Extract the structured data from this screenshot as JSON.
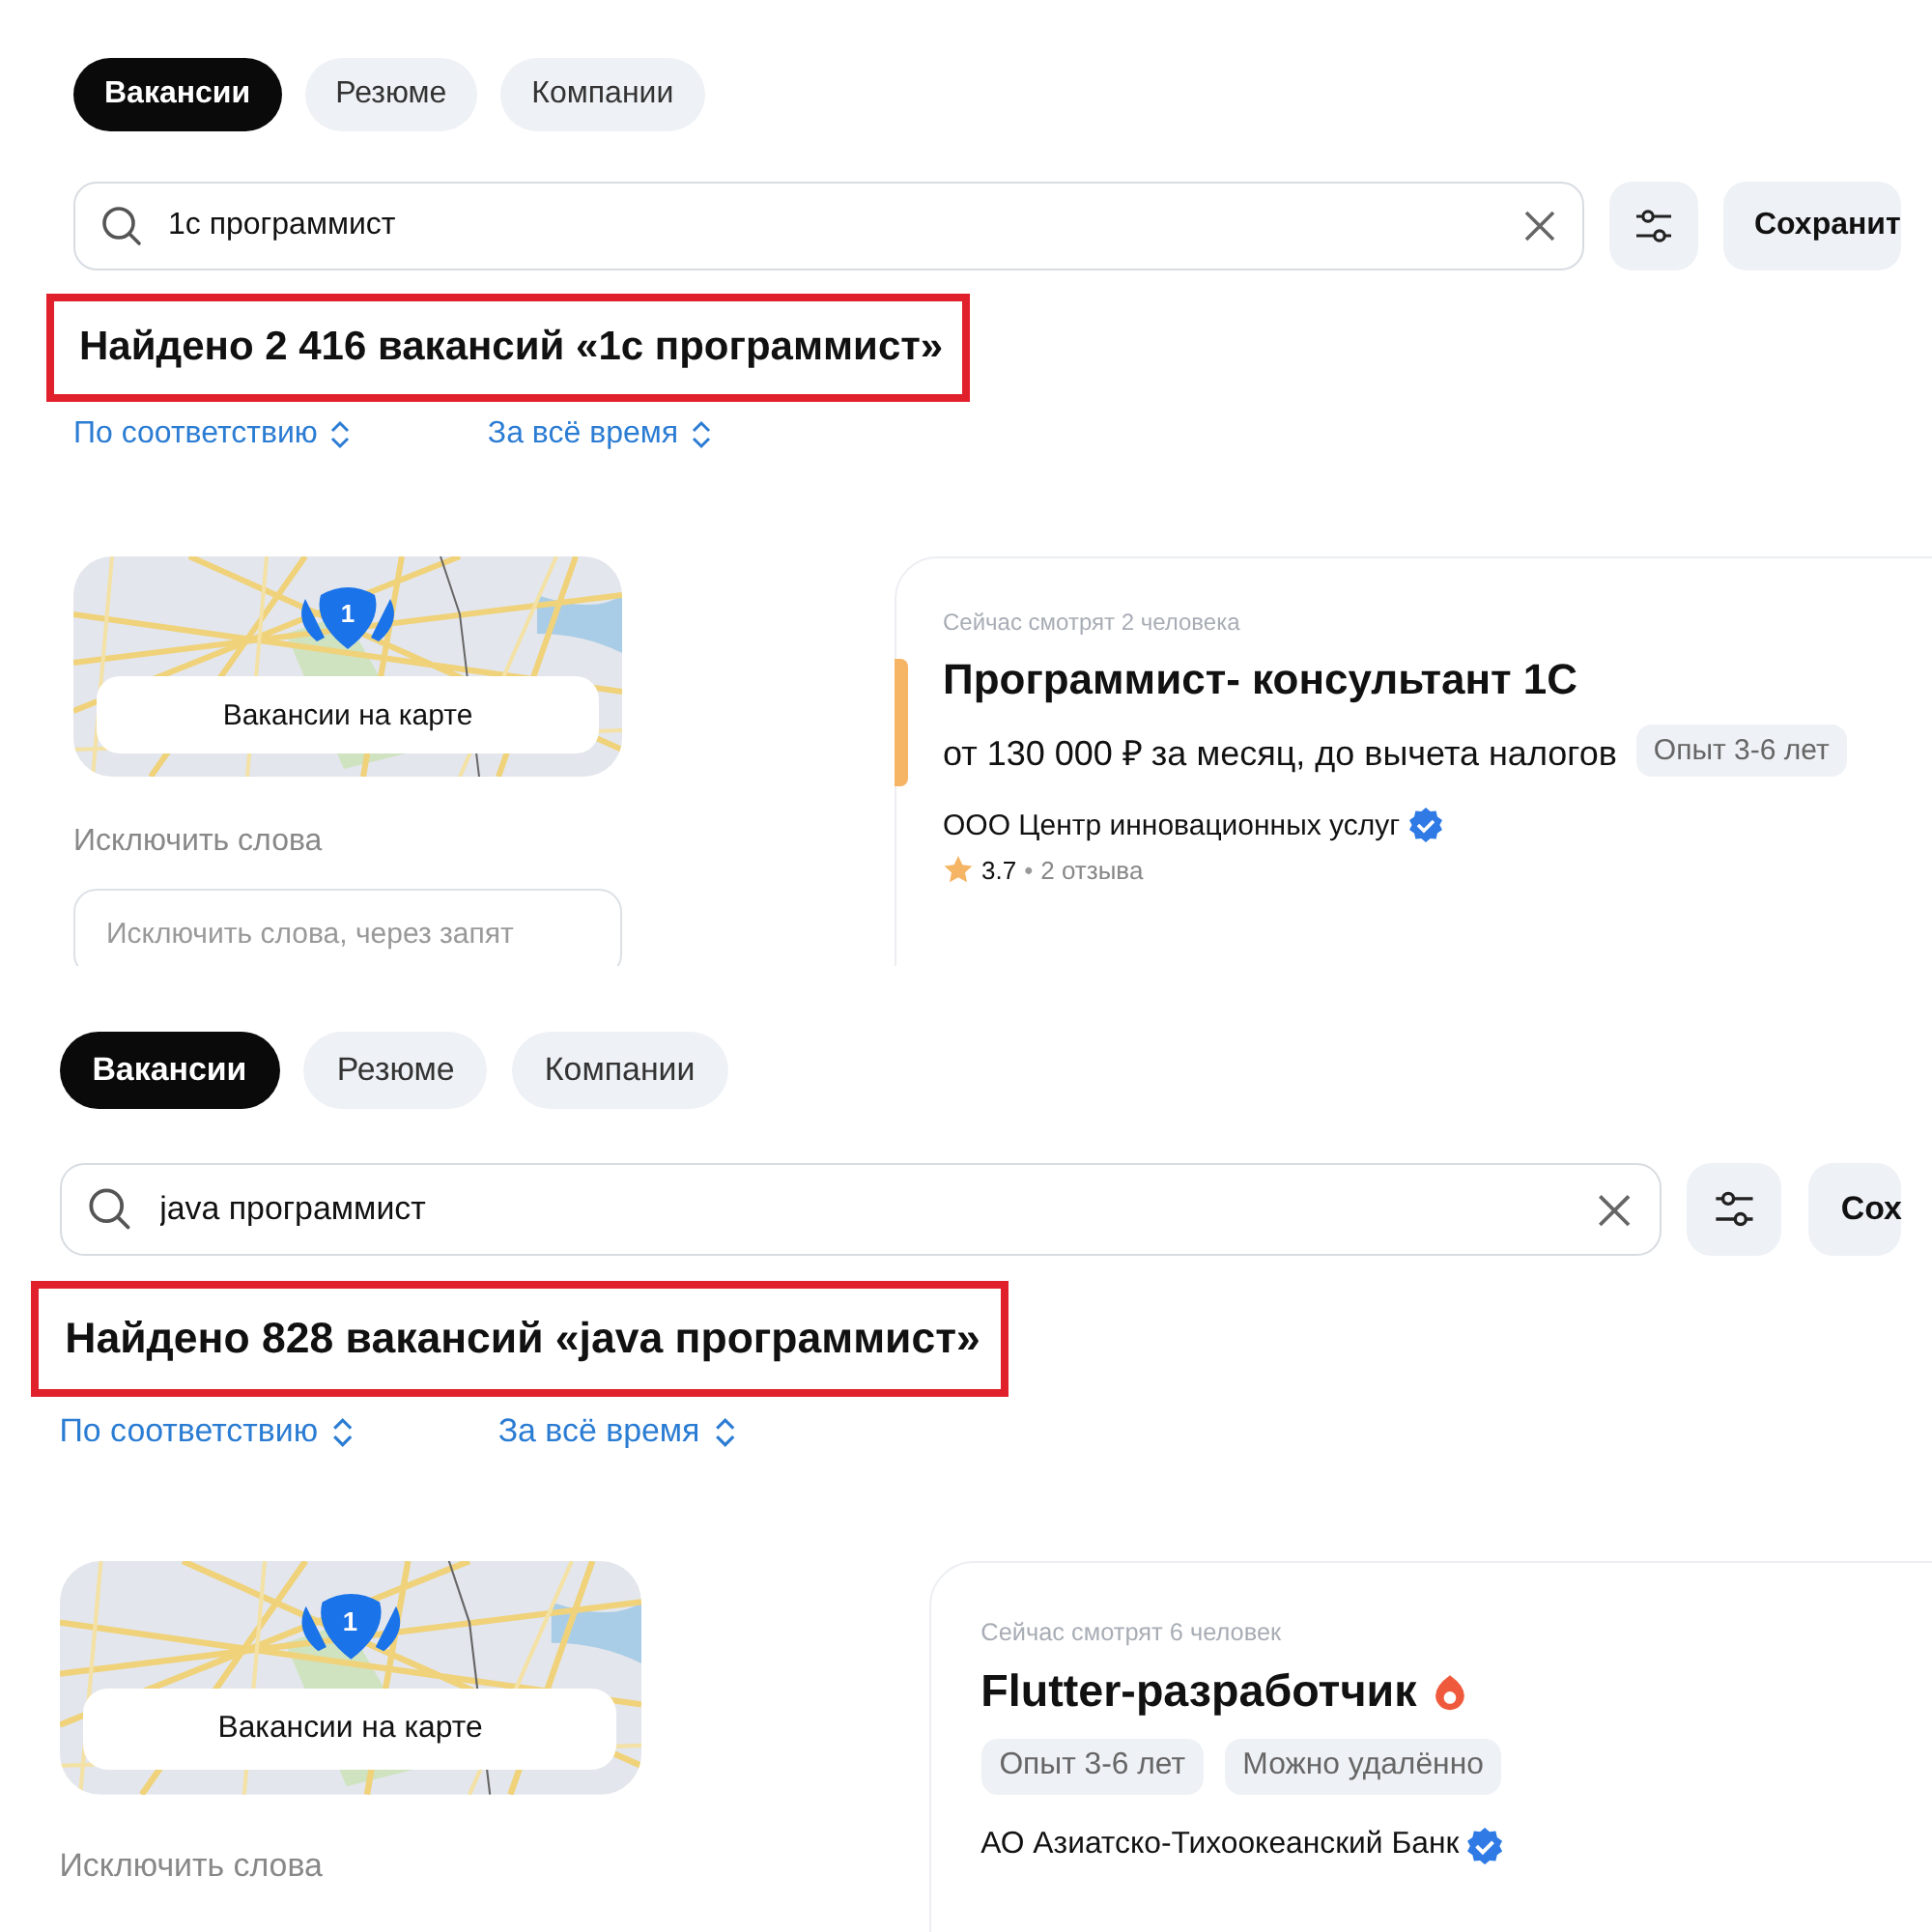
{
  "panels": [
    {
      "tabs": [
        {
          "label": "Вакансии",
          "selected": true
        },
        {
          "label": "Резюме",
          "selected": false
        },
        {
          "label": "Компании",
          "selected": false
        }
      ],
      "search": {
        "value": "1с программист"
      },
      "save_button": "Сохранит",
      "heading": {
        "text": "Найдено 2 416 вакансий «1с программист»",
        "outlined": true
      },
      "sort": [
        "По соответствию",
        "За всё время"
      ],
      "map": {
        "badge": "1",
        "button": "Вакансии на карте"
      },
      "exclude": {
        "label": "Исключить слова",
        "placeholder": "Исключить слова, через запят"
      },
      "vacancy": {
        "watchers": "Сейчас смотрят 2 человека",
        "title": "Программист- консультант 1С",
        "hot": false,
        "highlighted": true,
        "salary": "от 130 000 ₽ за месяц, до вычета налогов",
        "tags": [
          "Опыт 3-6 лет"
        ],
        "company": "ООО Центр инновационных услуг",
        "verified": true,
        "rating": "3.7",
        "separator": "•",
        "reviews": "2 отзыва"
      }
    },
    {
      "tabs": [
        {
          "label": "Вакансии",
          "selected": true
        },
        {
          "label": "Резюме",
          "selected": false
        },
        {
          "label": "Компании",
          "selected": false
        }
      ],
      "search": {
        "value": "java программист"
      },
      "save_button": "Сох",
      "heading": {
        "text": "Найдено 828 вакансий «java программист»",
        "outlined": true
      },
      "sort": [
        "По соответствию",
        "За всё время"
      ],
      "map": {
        "badge": "1",
        "button": "Вакансии на карте"
      },
      "exclude": {
        "label": "Исключить слова"
      },
      "vacancy": {
        "watchers": "Сейчас смотрят 6 человек",
        "title": "Flutter-разработчик",
        "hot": true,
        "highlighted": false,
        "tags": [
          "Опыт 3-6 лет",
          "Можно удалённо"
        ],
        "company": "АО Азиатско-Тихоокеанский Банк",
        "verified": true
      }
    }
  ]
}
